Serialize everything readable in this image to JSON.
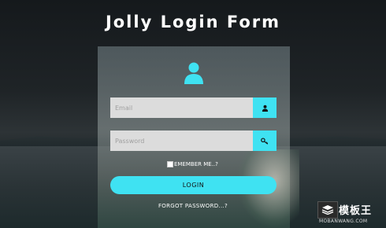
{
  "title": "Jolly Login Form",
  "form": {
    "email_placeholder": "Email",
    "password_placeholder": "Password",
    "remember_label": "EMEMBER ME..?",
    "login_label": "LOGIN",
    "forgot_label": "FORGOT PASSWORD...?"
  },
  "icons": {
    "avatar": "user-icon",
    "email": "person-icon",
    "password": "key-icon"
  },
  "watermark": {
    "text_zh": "模板王",
    "text_en": "MOBANWANG.COM"
  },
  "colors": {
    "accent": "#3fe2f2",
    "field_bg": "#dcdcdc",
    "text": "#ffffff"
  }
}
